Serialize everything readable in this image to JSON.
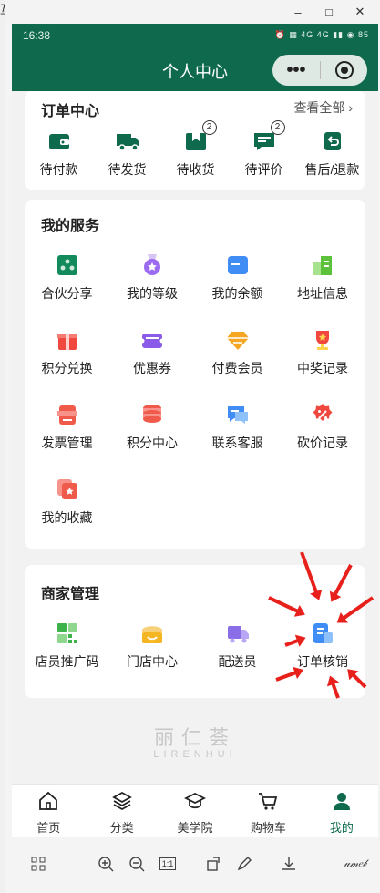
{
  "window": {
    "left_edge_char": "亙",
    "min": "–",
    "max": "□",
    "close": "✕"
  },
  "status": {
    "time": "16:38",
    "icons": "⏰ ▦ 4G 4G ▮▮ ◉ 85"
  },
  "header": {
    "title": "个人中心",
    "more": "•••"
  },
  "orders": {
    "title": "订单中心",
    "view_all": "查看全部",
    "items": [
      {
        "label": "待付款",
        "icon": "wallet-icon",
        "badge": ""
      },
      {
        "label": "待发货",
        "icon": "truck-icon",
        "badge": ""
      },
      {
        "label": "待收货",
        "icon": "package-icon",
        "badge": "2"
      },
      {
        "label": "待评价",
        "icon": "comment-icon",
        "badge": "2"
      },
      {
        "label": "售后/退款",
        "icon": "refund-icon",
        "badge": ""
      }
    ]
  },
  "services": {
    "title": "我的服务",
    "items": [
      {
        "label": "合伙分享",
        "icon": "share-icon",
        "color": "#138a5c"
      },
      {
        "label": "我的等级",
        "icon": "medal-icon",
        "color": "#9b6cf0"
      },
      {
        "label": "我的余额",
        "icon": "card-icon",
        "color": "#3f8df5"
      },
      {
        "label": "地址信息",
        "icon": "building-icon",
        "color": "#5cc23c"
      },
      {
        "label": "积分兑换",
        "icon": "gift-icon",
        "color": "#f0483e"
      },
      {
        "label": "优惠券",
        "icon": "coupon-icon",
        "color": "#8a5be8"
      },
      {
        "label": "付费会员",
        "icon": "diamond-icon",
        "color": "#f5a623"
      },
      {
        "label": "中奖记录",
        "icon": "trophy-icon",
        "color": "#f0483e"
      },
      {
        "label": "发票管理",
        "icon": "invoice-icon",
        "color": "#f05a4a"
      },
      {
        "label": "积分中心",
        "icon": "coins-icon",
        "color": "#f05a4a"
      },
      {
        "label": "联系客服",
        "icon": "chat-icon",
        "color": "#3f8df5"
      },
      {
        "label": "砍价记录",
        "icon": "discount-icon",
        "color": "#f0483e"
      },
      {
        "label": "我的收藏",
        "icon": "favorite-icon",
        "color": "#f05a4a"
      }
    ]
  },
  "merchant": {
    "title": "商家管理",
    "items": [
      {
        "label": "店员推广码",
        "icon": "qrcode-icon",
        "color": "#3bb34a"
      },
      {
        "label": "门店中心",
        "icon": "store-icon",
        "color": "#f5b623"
      },
      {
        "label": "配送员",
        "icon": "delivery-icon",
        "color": "#8a6ee8"
      },
      {
        "label": "订单核销",
        "icon": "verify-icon",
        "color": "#3f8df5"
      }
    ]
  },
  "brand": {
    "cn": "丽仁荟",
    "en": "LIRENHUI"
  },
  "tabs": [
    {
      "label": "首页",
      "icon": "home-icon"
    },
    {
      "label": "分类",
      "icon": "layers-icon"
    },
    {
      "label": "美学院",
      "icon": "graduation-cap-icon"
    },
    {
      "label": "购物车",
      "icon": "cart-icon"
    },
    {
      "label": "我的",
      "icon": "user-icon"
    }
  ],
  "toolbar": {
    "ratio": "1:1",
    "logo": "𝓊𝓂𝑒𝒷"
  },
  "colors": {
    "primary": "#0f6a4d",
    "arrow": "#e8201b"
  }
}
